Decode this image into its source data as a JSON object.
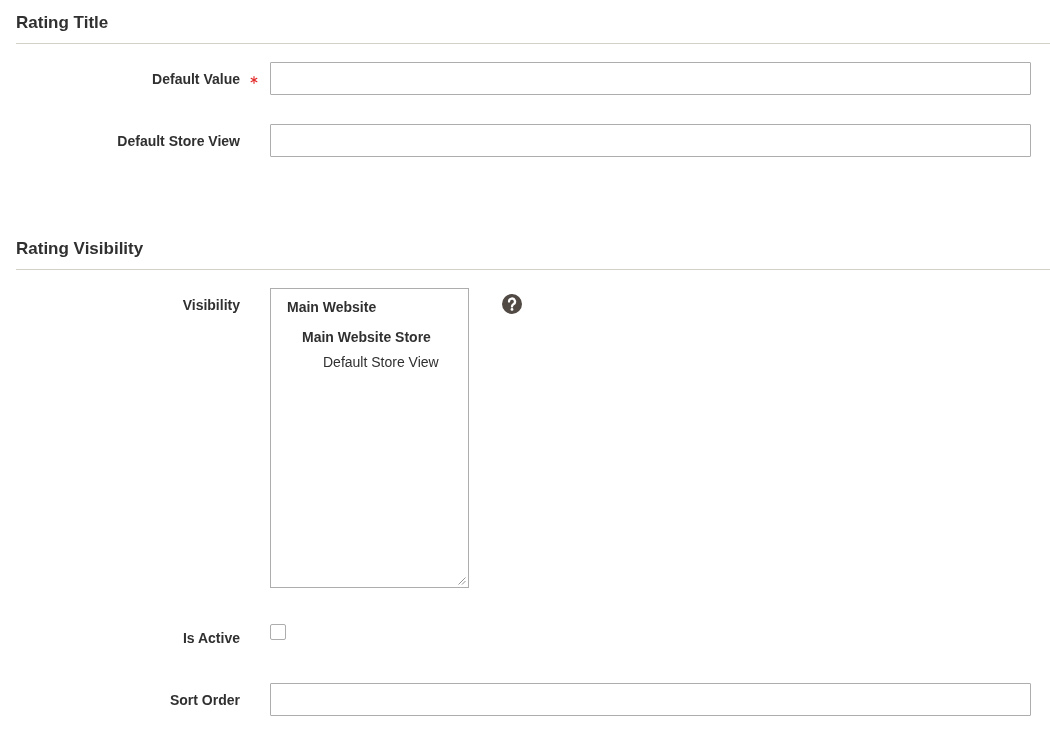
{
  "sections": [
    {
      "title": "Rating Title",
      "fields": [
        {
          "kind": "text",
          "label": "Default Value",
          "required": true
        },
        {
          "kind": "text",
          "label": "Default Store View",
          "required": false
        }
      ]
    },
    {
      "title": "Rating Visibility",
      "fields": [
        {
          "kind": "multiselect",
          "label": "Visibility",
          "required": false,
          "help": true,
          "options": [
            {
              "kind": "group",
              "label": "Main Website",
              "children": [
                {
                  "kind": "group",
                  "label": "Main Website Store",
                  "children": [
                    {
                      "kind": "option",
                      "label": "Default Store View",
                      "selected": false
                    }
                  ]
                }
              ]
            }
          ]
        },
        {
          "kind": "checkbox",
          "label": "Is Active",
          "required": false,
          "checked": false
        },
        {
          "kind": "text",
          "label": "Sort Order",
          "required": false
        }
      ]
    }
  ]
}
